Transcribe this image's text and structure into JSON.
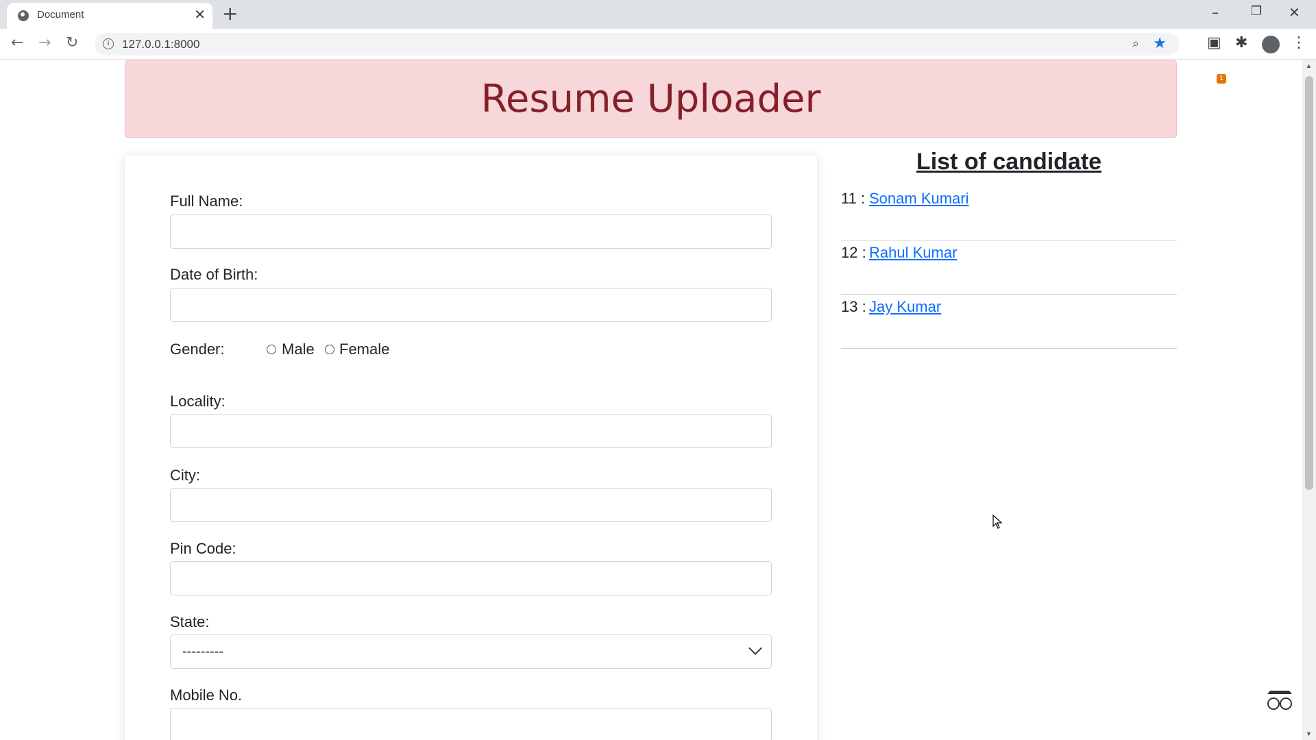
{
  "browser": {
    "tab_title": "Document",
    "url": "127.0.0.1:8000",
    "extension_badge": "1"
  },
  "page": {
    "header_title": "Resume Uploader",
    "form": {
      "full_name_label": "Full Name:",
      "full_name_value": "",
      "dob_label": "Date of Birth:",
      "dob_value": "",
      "gender_label": "Gender:",
      "gender_options": [
        "Male",
        "Female"
      ],
      "locality_label": "Locality:",
      "locality_value": "",
      "city_label": "City:",
      "city_value": "",
      "pin_label": "Pin Code:",
      "pin_value": "",
      "state_label": "State:",
      "state_selected": "---------",
      "mobile_label": "Mobile No."
    },
    "candidates": {
      "heading": "List of candidate",
      "items": [
        {
          "num": "11 :",
          "name": "Sonam Kumari"
        },
        {
          "num": "12 :",
          "name": "Rahul Kumar"
        },
        {
          "num": "13 :",
          "name": "Jay Kumar"
        }
      ]
    }
  },
  "colors": {
    "header_bg": "#f8d7da",
    "header_text": "#842029",
    "link": "#0d6efd"
  }
}
